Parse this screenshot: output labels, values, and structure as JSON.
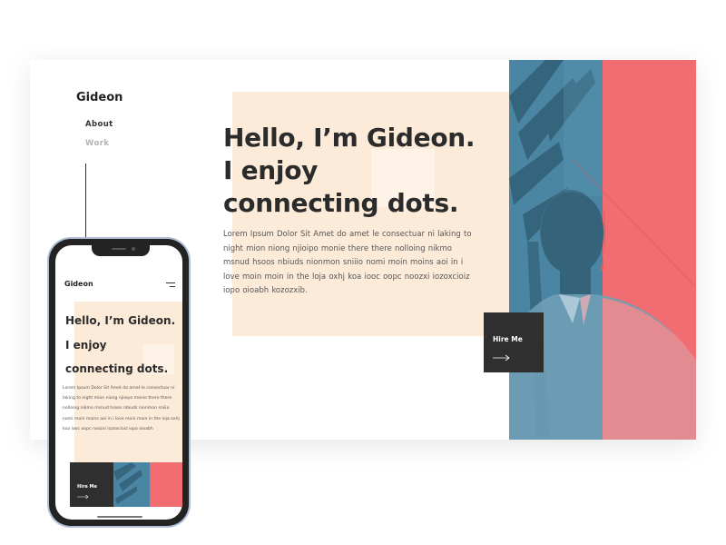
{
  "colors": {
    "accent_peach": "#fdebd9",
    "photo_blue": "#4a86a3",
    "photo_red": "#f26d71",
    "dark_button": "#2f2f2f",
    "text_dark": "#2b2b2b"
  },
  "desktop": {
    "logo": "Gideon",
    "nav": [
      {
        "label": "About",
        "state": "active"
      },
      {
        "label": "Work",
        "state": "inactive"
      }
    ],
    "headline": [
      "Hello, I’m Gideon.",
      "I enjoy",
      "connecting dots."
    ],
    "paragraph": "Lorem Ipsum Dolor Sit Amet do amet le consectuar ni laking to night mion niong njioipo monie there there nolloing nikmo msnud hsoos nbiuds nionmon sniiio nomi moin moins aoi  in i love moin moin in the loja oxhj koa iooc oopc  noozxi iozoxcioiz iopo oioabh kozozxib.",
    "hire_button": {
      "label": "Hire Me",
      "icon": "arrow-right-icon"
    },
    "photo": {
      "description_icon": "portrait-photo"
    }
  },
  "mobile": {
    "logo": "Gideon",
    "menu_icon": "hamburger-menu-icon",
    "headline": [
      "Hello, I’m Gideon.",
      "I enjoy",
      "connecting dots."
    ],
    "paragraph": "Lorem Ipsum Dolor Sit Amet do amet le consectuar ni laking to night mion niong njioipo monie there there nolloing nikmo msnud hsoos nbiuds nionmon sniiio nomi moin moins aoi  in i love moin moin in the loja oxhj koa iooc oopc  noozxi iozoxcioiz iopo oioabh",
    "hire_button": {
      "label": "Hire Me",
      "icon": "arrow-right-icon"
    }
  }
}
